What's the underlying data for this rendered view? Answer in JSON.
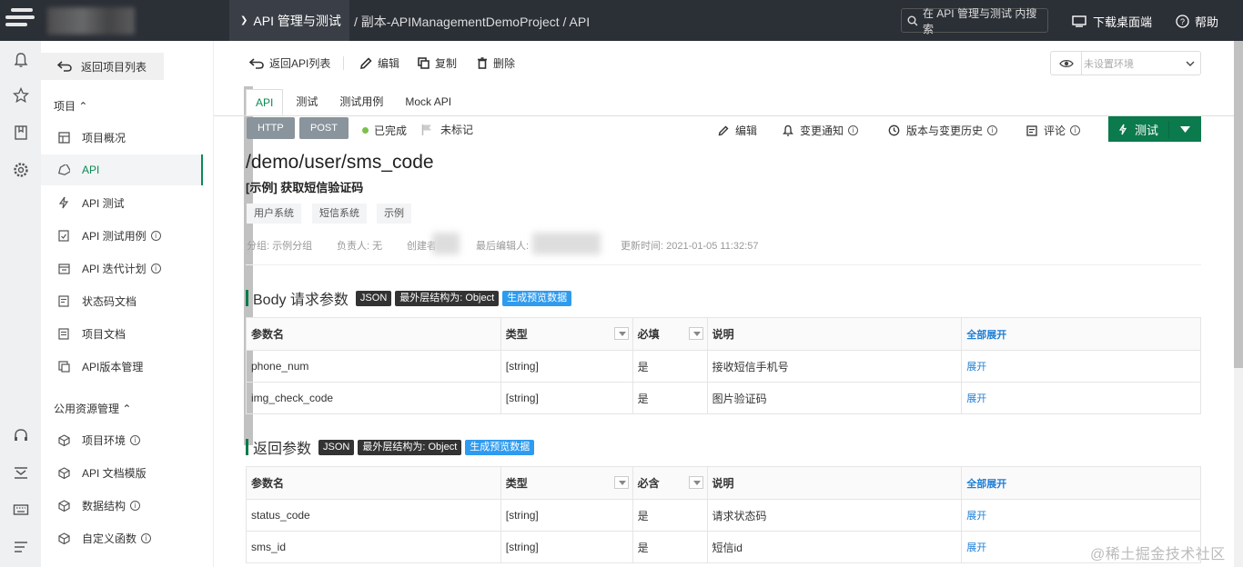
{
  "topbar": {
    "module": "API 管理与测试",
    "breadcrumb": "/ 副本-APIManagementDemoProject / API",
    "search_placeholder": "在 API 管理与测试 内搜索",
    "download": "下载桌面端",
    "help": "帮助"
  },
  "sidebar": {
    "back": "返回项目列表",
    "project_section": "项目 ⌃",
    "items": [
      {
        "label": "项目概况",
        "icon": "dashboard-icon"
      },
      {
        "label": "API",
        "icon": "api-tag-icon"
      },
      {
        "label": "API 测试",
        "icon": "lightning-icon"
      },
      {
        "label": "API 测试用例",
        "icon": "clipboard-icon"
      },
      {
        "label": "API 迭代计划",
        "icon": "calendar-icon"
      },
      {
        "label": "状态码文档",
        "icon": "document-icon"
      },
      {
        "label": "项目文档",
        "icon": "document-icon"
      },
      {
        "label": "API版本管理",
        "icon": "version-icon"
      }
    ],
    "public_section": "公用资源管理 ⌃",
    "public_items": [
      {
        "label": "项目环境"
      },
      {
        "label": "API 文档模版"
      },
      {
        "label": "数据结构"
      },
      {
        "label": "自定义函数"
      }
    ]
  },
  "toolbar": {
    "back_api_list": "返回API列表",
    "edit": "编辑",
    "copy": "复制",
    "delete": "删除",
    "env_placeholder": "未设置环境"
  },
  "tabs": [
    "API",
    "测试",
    "测试用例",
    "Mock API"
  ],
  "api": {
    "protocol": "HTTP",
    "method": "POST",
    "status": "已完成",
    "mark": "未标记",
    "actions": {
      "edit": "编辑",
      "notify": "变更通知",
      "history": "版本与变更历史",
      "comment": "评论",
      "test": "测试"
    },
    "path": "/demo/user/sms_code",
    "title": "[示例] 获取短信验证码",
    "tags": [
      "用户系统",
      "短信系统",
      "示例"
    ],
    "meta": {
      "group": "分组: 示例分组",
      "owner": "负责人: 无",
      "creator": "创建者:",
      "editor": "最后编辑人:",
      "updated": "更新时间: 2021-01-05 11:32:57"
    }
  },
  "body_params": {
    "title": "Body 请求参数",
    "pill_json": "JSON",
    "pill_struct": "最外层结构为: Object",
    "pill_preview": "生成预览数据",
    "headers": [
      "参数名",
      "类型",
      "必填",
      "说明",
      "全部展开"
    ],
    "rows": [
      {
        "name": "phone_num",
        "type": "[string]",
        "required": "是",
        "desc": "接收短信手机号",
        "expand": "展开"
      },
      {
        "name": "img_check_code",
        "type": "[string]",
        "required": "是",
        "desc": "图片验证码",
        "expand": "展开"
      }
    ]
  },
  "return_params": {
    "title": "返回参数",
    "pill_json": "JSON",
    "pill_struct": "最外层结构为: Object",
    "pill_preview": "生成预览数据",
    "headers": [
      "参数名",
      "类型",
      "必含",
      "说明",
      "全部展开"
    ],
    "rows": [
      {
        "name": "status_code",
        "type": "[string]",
        "required": "是",
        "desc": "请求状态码",
        "expand": "展开"
      },
      {
        "name": "sms_id",
        "type": "[string]",
        "required": "是",
        "desc": "短信id",
        "expand": "展开"
      }
    ]
  },
  "watermark": "@稀土掘金技术社区",
  "colors": {
    "accent": "#0b7a4c",
    "link": "#1f7fd6",
    "topbar": "#2b2f36"
  }
}
